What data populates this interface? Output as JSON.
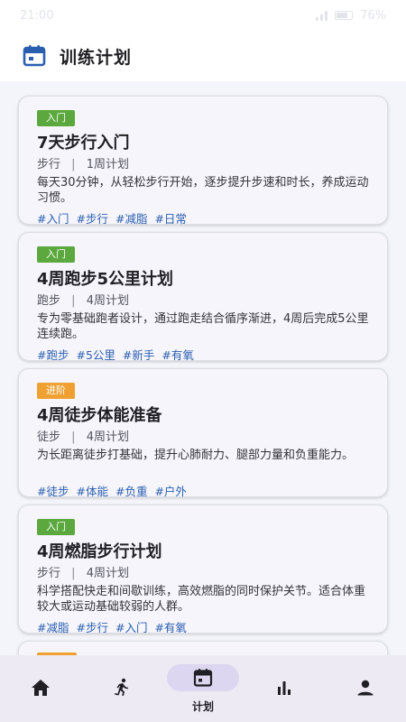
{
  "status_bar": {
    "time": "21:00",
    "battery": "76%"
  },
  "header": {
    "title": "训练计划",
    "icon": "calendar-icon"
  },
  "plans": [
    {
      "level": "入门",
      "level_color": "#5aa83e",
      "title": "7天步行入门",
      "type": "步行",
      "duration": "1周计划",
      "description": "每天30分钟，从轻松步行开始，逐步提升步速和时长，养成运动习惯。",
      "tags": [
        "#入门",
        "#步行",
        "#减脂",
        "#日常"
      ]
    },
    {
      "level": "入门",
      "level_color": "#5aa83e",
      "title": "4周跑步5公里计划",
      "type": "跑步",
      "duration": "4周计划",
      "description": "专为零基础跑者设计，通过跑走结合循序渐进，4周后完成5公里连续跑。",
      "tags": [
        "#跑步",
        "#5公里",
        "#新手",
        "#有氧"
      ]
    },
    {
      "level": "进阶",
      "level_color": "#f0a030",
      "title": "4周徒步体能准备",
      "type": "徒步",
      "duration": "4周计划",
      "description": "为长距离徒步打基础，提升心肺耐力、腿部力量和负重能力。",
      "tags": [
        "#徒步",
        "#体能",
        "#负重",
        "#户外"
      ]
    },
    {
      "level": "入门",
      "level_color": "#5aa83e",
      "title": "4周燃脂步行计划",
      "type": "步行",
      "duration": "4周计划",
      "description": "科学搭配快走和间歇训练，高效燃脂的同时保护关节。适合体重较大或运动基础较弱的人群。",
      "tags": [
        "#减脂",
        "#步行",
        "#入门",
        "#有氧"
      ]
    }
  ],
  "meta_separator": "|",
  "nav": {
    "items": [
      {
        "name": "home",
        "icon": "home-icon",
        "label": ""
      },
      {
        "name": "activity",
        "icon": "running-icon",
        "label": ""
      },
      {
        "name": "plan",
        "icon": "calendar-icon",
        "label": "计划",
        "active": true
      },
      {
        "name": "stats",
        "icon": "bar-chart-icon",
        "label": ""
      },
      {
        "name": "profile",
        "icon": "person-icon",
        "label": ""
      }
    ]
  },
  "colors": {
    "accent": "#2a5fb0",
    "nav_active_bg": "#dcd6f0",
    "nav_bg": "#eeeaf4"
  }
}
